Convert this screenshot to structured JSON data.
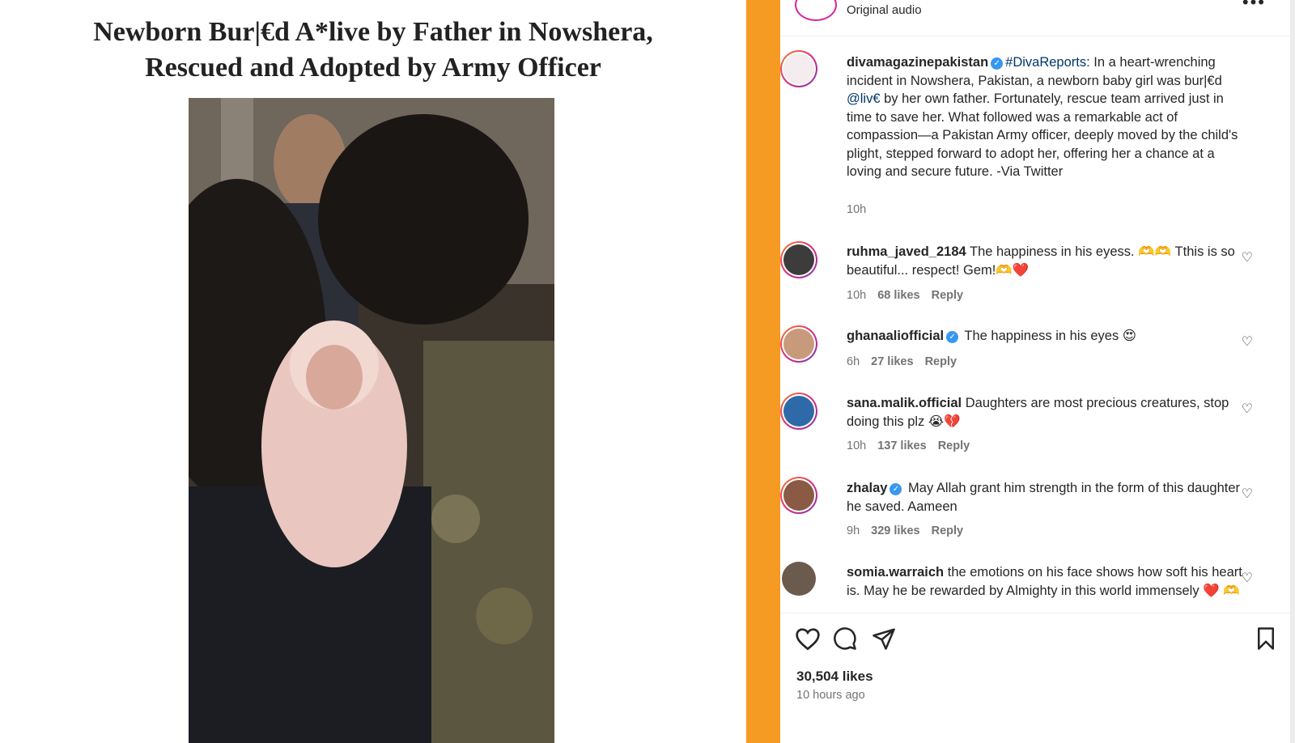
{
  "headline": {
    "line1": "Newborn Bur|€d A*live by Father in Nowshera,",
    "line2": "Rescued and Adopted by Army Officer"
  },
  "topbar": {
    "audio": "Original audio",
    "more": "•••"
  },
  "caption": {
    "user": "divamagazinepakistan",
    "hashtag": "#DivaReports",
    "text1": ": In a heart-wrenching incident in Nowshera, Pakistan, a newborn baby girl was bur|€d ",
    "mention": "@liv€",
    "text2": " by her own father. Fortunately, rescue team arrived just in time to save her. What followed was a remarkable act of compassion—a Pakistan Army officer, deeply moved by the child's plight, stepped forward to adopt her, offering her a chance at a loving and secure future. -Via Twitter",
    "time": "10h"
  },
  "comments": [
    {
      "user": "ruhma_javed_2184",
      "verified": false,
      "text": "The happiness in his eyess. 🫶🫶 Tthis is so beautiful... respect! Gem!🫶❤️",
      "time": "10h",
      "likes": "68 likes",
      "reply": "Reply"
    },
    {
      "user": "ghanaaliofficial",
      "verified": true,
      "text": "The happiness in his eyes 😍",
      "time": "6h",
      "likes": "27 likes",
      "reply": "Reply"
    },
    {
      "user": "sana.malik.official",
      "verified": false,
      "text": "Daughters are most precious creatures, stop doing this plz 😭💔",
      "time": "10h",
      "likes": "137 likes",
      "reply": "Reply"
    },
    {
      "user": "zhalay",
      "verified": true,
      "text": "May Allah grant him strength in the form of this daughter he saved. Aameen",
      "time": "9h",
      "likes": "329 likes",
      "reply": "Reply"
    },
    {
      "user": "somia.warraich",
      "verified": false,
      "text": "the emotions on his face shows how soft his heart is. May he be rewarded by Almighty in this world immensely ❤️ 🫶",
      "time": "",
      "likes": "",
      "reply": ""
    }
  ],
  "footer": {
    "likes": "30,504 likes",
    "time": "10 hours ago"
  }
}
